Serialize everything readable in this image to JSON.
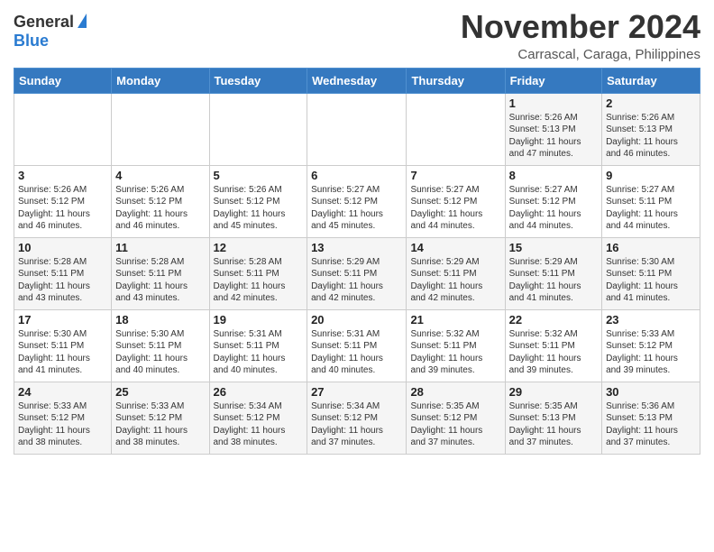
{
  "header": {
    "logo_general": "General",
    "logo_blue": "Blue",
    "month_title": "November 2024",
    "location": "Carrascal, Caraga, Philippines"
  },
  "weekdays": [
    "Sunday",
    "Monday",
    "Tuesday",
    "Wednesday",
    "Thursday",
    "Friday",
    "Saturday"
  ],
  "weeks": [
    [
      {
        "day": "",
        "info": ""
      },
      {
        "day": "",
        "info": ""
      },
      {
        "day": "",
        "info": ""
      },
      {
        "day": "",
        "info": ""
      },
      {
        "day": "",
        "info": ""
      },
      {
        "day": "1",
        "info": "Sunrise: 5:26 AM\nSunset: 5:13 PM\nDaylight: 11 hours\nand 47 minutes."
      },
      {
        "day": "2",
        "info": "Sunrise: 5:26 AM\nSunset: 5:13 PM\nDaylight: 11 hours\nand 46 minutes."
      }
    ],
    [
      {
        "day": "3",
        "info": "Sunrise: 5:26 AM\nSunset: 5:12 PM\nDaylight: 11 hours\nand 46 minutes."
      },
      {
        "day": "4",
        "info": "Sunrise: 5:26 AM\nSunset: 5:12 PM\nDaylight: 11 hours\nand 46 minutes."
      },
      {
        "day": "5",
        "info": "Sunrise: 5:26 AM\nSunset: 5:12 PM\nDaylight: 11 hours\nand 45 minutes."
      },
      {
        "day": "6",
        "info": "Sunrise: 5:27 AM\nSunset: 5:12 PM\nDaylight: 11 hours\nand 45 minutes."
      },
      {
        "day": "7",
        "info": "Sunrise: 5:27 AM\nSunset: 5:12 PM\nDaylight: 11 hours\nand 44 minutes."
      },
      {
        "day": "8",
        "info": "Sunrise: 5:27 AM\nSunset: 5:12 PM\nDaylight: 11 hours\nand 44 minutes."
      },
      {
        "day": "9",
        "info": "Sunrise: 5:27 AM\nSunset: 5:11 PM\nDaylight: 11 hours\nand 44 minutes."
      }
    ],
    [
      {
        "day": "10",
        "info": "Sunrise: 5:28 AM\nSunset: 5:11 PM\nDaylight: 11 hours\nand 43 minutes."
      },
      {
        "day": "11",
        "info": "Sunrise: 5:28 AM\nSunset: 5:11 PM\nDaylight: 11 hours\nand 43 minutes."
      },
      {
        "day": "12",
        "info": "Sunrise: 5:28 AM\nSunset: 5:11 PM\nDaylight: 11 hours\nand 42 minutes."
      },
      {
        "day": "13",
        "info": "Sunrise: 5:29 AM\nSunset: 5:11 PM\nDaylight: 11 hours\nand 42 minutes."
      },
      {
        "day": "14",
        "info": "Sunrise: 5:29 AM\nSunset: 5:11 PM\nDaylight: 11 hours\nand 42 minutes."
      },
      {
        "day": "15",
        "info": "Sunrise: 5:29 AM\nSunset: 5:11 PM\nDaylight: 11 hours\nand 41 minutes."
      },
      {
        "day": "16",
        "info": "Sunrise: 5:30 AM\nSunset: 5:11 PM\nDaylight: 11 hours\nand 41 minutes."
      }
    ],
    [
      {
        "day": "17",
        "info": "Sunrise: 5:30 AM\nSunset: 5:11 PM\nDaylight: 11 hours\nand 41 minutes."
      },
      {
        "day": "18",
        "info": "Sunrise: 5:30 AM\nSunset: 5:11 PM\nDaylight: 11 hours\nand 40 minutes."
      },
      {
        "day": "19",
        "info": "Sunrise: 5:31 AM\nSunset: 5:11 PM\nDaylight: 11 hours\nand 40 minutes."
      },
      {
        "day": "20",
        "info": "Sunrise: 5:31 AM\nSunset: 5:11 PM\nDaylight: 11 hours\nand 40 minutes."
      },
      {
        "day": "21",
        "info": "Sunrise: 5:32 AM\nSunset: 5:11 PM\nDaylight: 11 hours\nand 39 minutes."
      },
      {
        "day": "22",
        "info": "Sunrise: 5:32 AM\nSunset: 5:11 PM\nDaylight: 11 hours\nand 39 minutes."
      },
      {
        "day": "23",
        "info": "Sunrise: 5:33 AM\nSunset: 5:12 PM\nDaylight: 11 hours\nand 39 minutes."
      }
    ],
    [
      {
        "day": "24",
        "info": "Sunrise: 5:33 AM\nSunset: 5:12 PM\nDaylight: 11 hours\nand 38 minutes."
      },
      {
        "day": "25",
        "info": "Sunrise: 5:33 AM\nSunset: 5:12 PM\nDaylight: 11 hours\nand 38 minutes."
      },
      {
        "day": "26",
        "info": "Sunrise: 5:34 AM\nSunset: 5:12 PM\nDaylight: 11 hours\nand 38 minutes."
      },
      {
        "day": "27",
        "info": "Sunrise: 5:34 AM\nSunset: 5:12 PM\nDaylight: 11 hours\nand 37 minutes."
      },
      {
        "day": "28",
        "info": "Sunrise: 5:35 AM\nSunset: 5:12 PM\nDaylight: 11 hours\nand 37 minutes."
      },
      {
        "day": "29",
        "info": "Sunrise: 5:35 AM\nSunset: 5:13 PM\nDaylight: 11 hours\nand 37 minutes."
      },
      {
        "day": "30",
        "info": "Sunrise: 5:36 AM\nSunset: 5:13 PM\nDaylight: 11 hours\nand 37 minutes."
      }
    ]
  ]
}
